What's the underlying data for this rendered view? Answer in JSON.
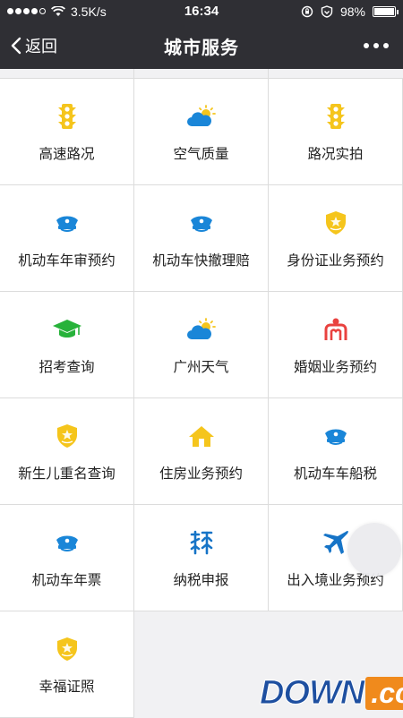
{
  "status_bar": {
    "speed": "3.5K/s",
    "time": "16:34",
    "battery": "98%",
    "battery_level": 0.98
  },
  "navbar": {
    "back_label": "返回",
    "title": "城市服务"
  },
  "colors": {
    "yellow": "#f5c51c",
    "blue": "#1a86d8",
    "green": "#27b23a",
    "red": "#e9423f",
    "navy": "#1674c7"
  },
  "services": [
    {
      "label": "高速路况",
      "icon": "traffic-light-icon"
    },
    {
      "label": "空气质量",
      "icon": "weather-icon"
    },
    {
      "label": "路况实拍",
      "icon": "traffic-light-icon"
    },
    {
      "label": "机动车年审预约",
      "icon": "police-cap-icon"
    },
    {
      "label": "机动车快撤理赔",
      "icon": "police-cap-icon"
    },
    {
      "label": "身份证业务预约",
      "icon": "police-badge-icon"
    },
    {
      "label": "招考查询",
      "icon": "graduation-cap-icon"
    },
    {
      "label": "广州天气",
      "icon": "weather-icon"
    },
    {
      "label": "婚姻业务预约",
      "icon": "marriage-icon"
    },
    {
      "label": "新生儿重名查询",
      "icon": "police-badge-icon"
    },
    {
      "label": "住房业务预约",
      "icon": "house-icon"
    },
    {
      "label": "机动车车船税",
      "icon": "police-cap-icon"
    },
    {
      "label": "机动车年票",
      "icon": "police-cap-icon"
    },
    {
      "label": "纳税申报",
      "icon": "tax-icon"
    },
    {
      "label": "出入境业务预约",
      "icon": "airplane-icon"
    },
    {
      "label": "幸福证照",
      "icon": "police-badge-icon"
    }
  ],
  "watermark": {
    "text": "DOWN",
    "suffix": ".cc"
  }
}
